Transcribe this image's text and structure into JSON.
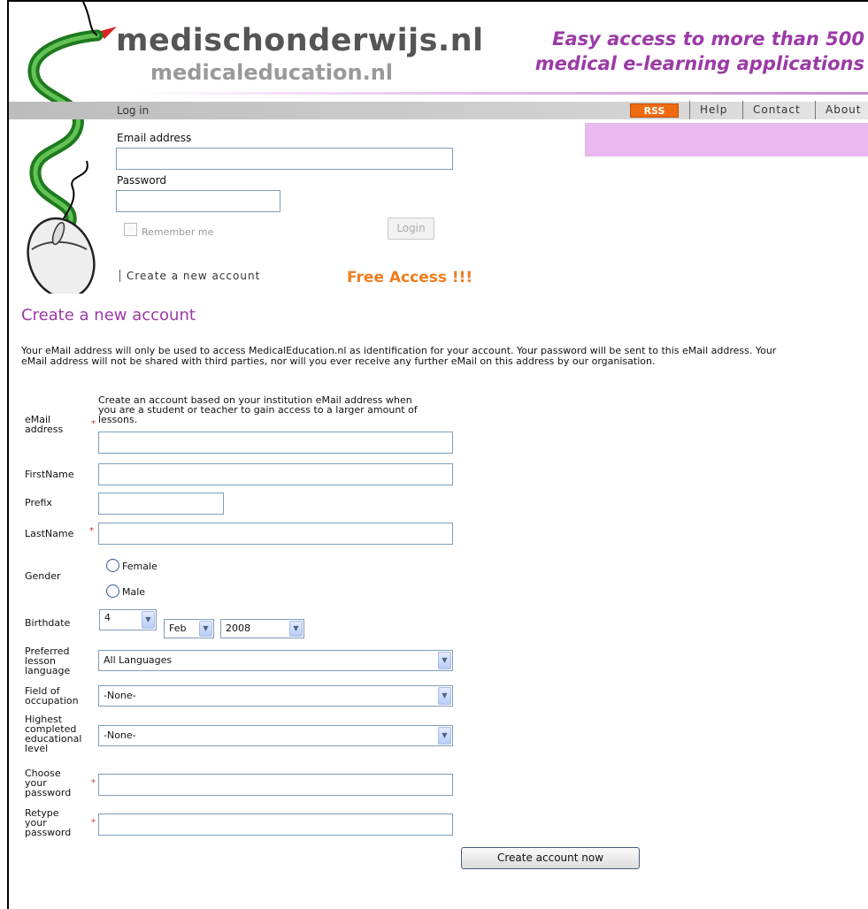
{
  "header": {
    "logo_main": "medischonderwijs.nl",
    "logo_sub": "medicaleducation.nl",
    "tagline_line1": "Easy access to more than 500",
    "tagline_line2": "medical e-learning applications",
    "accent_color": "#9b3aa6"
  },
  "nav": {
    "login_label": "Log in",
    "rss_label": "RSS",
    "help": "Help",
    "contact": "Contact",
    "about": "About"
  },
  "login": {
    "email_label": "Email address",
    "email_value": "",
    "password_label": "Password",
    "password_value": "",
    "remember_label": "Remember me",
    "login_button": "Login",
    "create_link": "Create a new account",
    "free_access": "Free Access !!!"
  },
  "form": {
    "title": "Create a new account",
    "intro_line1": "Your eMail address will only be used to access MedicalEducation.nl as identification for your account. Your password will be sent to this eMail address. Your",
    "intro_line2": "eMail address will not be shared with third parties, nor will you ever receive any further eMail on this address by our organisation.",
    "email_help_1": "Create an account based on your institution eMail address when",
    "email_help_2": "you are a student or teacher to gain access to a larger amount of",
    "email_help_3": "lessons.",
    "required_marker": "*",
    "labels": {
      "email_1": "eMail",
      "email_2": "address",
      "firstname": "FirstName",
      "prefix": "Prefix",
      "lastname": "LastName",
      "gender": "Gender",
      "birthdate": "Birthdate",
      "lang_1": "Preferred",
      "lang_2": "lesson",
      "lang_3": "language",
      "field_1": "Field of",
      "field_2": "occupation",
      "level_1": "Highest",
      "level_2": "completed",
      "level_3": "educational",
      "level_4": "level",
      "pw_1": "Choose",
      "pw_2": "your",
      "pw_3": "password",
      "retype_1": "Retype",
      "retype_2": "your",
      "retype_3": "password"
    },
    "gender_options": [
      "Female",
      "Male"
    ],
    "birth_day": "4",
    "birth_month": "Feb",
    "birth_year": "2008",
    "language_value": "All Languages",
    "occupation_value": "-None-",
    "education_value": "-None-",
    "submit_label": "Create account now"
  }
}
